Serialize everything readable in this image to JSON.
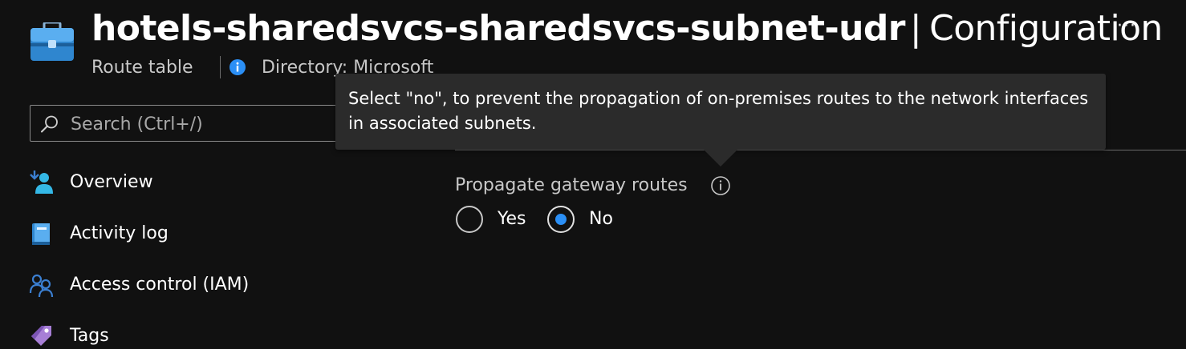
{
  "header": {
    "resource_name": "hotels-sharedsvcs-sharedsvcs-subnet-udr",
    "separator": "|",
    "blade": "Configuration",
    "resource_type": "Route table",
    "directory": "Directory: Microsoft",
    "more_glyph": "···"
  },
  "search": {
    "placeholder": "Search (Ctrl+/)"
  },
  "sidebar": {
    "items": [
      {
        "label": "Overview",
        "icon": "overview-icon"
      },
      {
        "label": "Activity log",
        "icon": "activity-log-icon"
      },
      {
        "label": "Access control (IAM)",
        "icon": "iam-icon"
      },
      {
        "label": "Tags",
        "icon": "tag-icon"
      }
    ]
  },
  "content": {
    "propagate_label": "Propagate gateway routes",
    "options": [
      {
        "label": "Yes",
        "selected": false
      },
      {
        "label": "No",
        "selected": true
      }
    ]
  },
  "tooltip": {
    "text": "Select \"no\", to prevent the propagation of on-premises routes to the network interfaces in associated subnets."
  },
  "colors": {
    "background": "#111111",
    "accent": "#2b8ff5",
    "tooltip_bg": "#2b2b2b"
  }
}
